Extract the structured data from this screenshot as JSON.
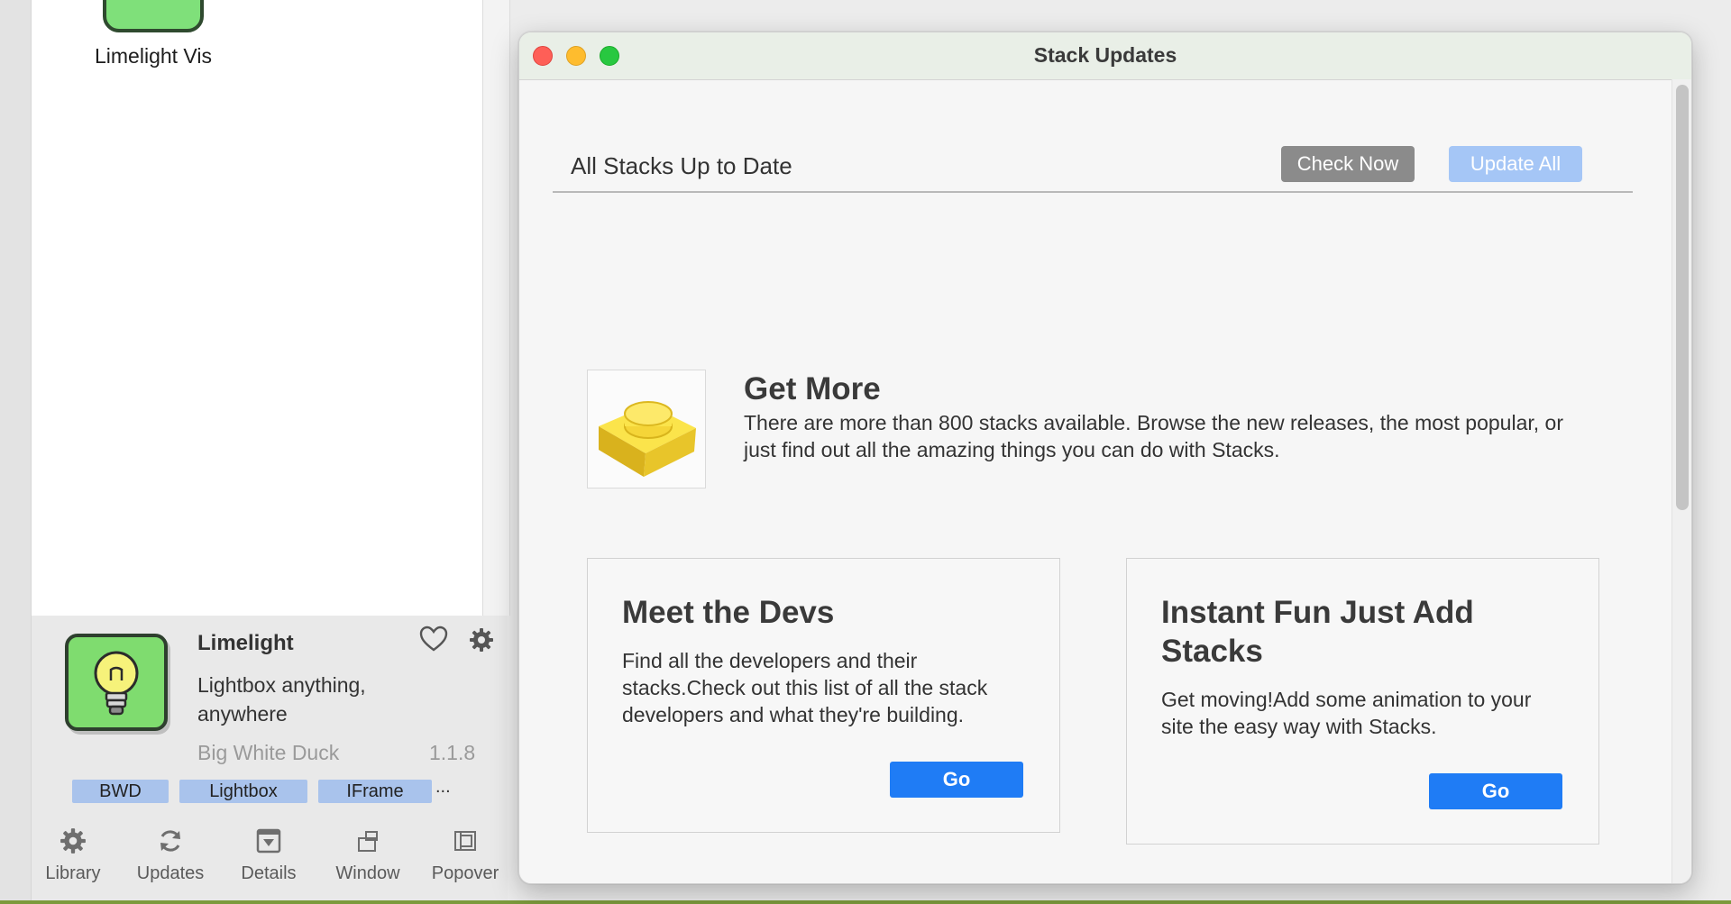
{
  "library": {
    "top_stack_name": "Limelight Vis"
  },
  "detail": {
    "title": "Limelight",
    "description": "Lightbox anything, anywhere",
    "author": "Big White Duck",
    "version": "1.1.8",
    "tags": [
      "BWD",
      "Lightbox",
      "IFrame"
    ],
    "tags_more": "..."
  },
  "toolbar": {
    "items": [
      {
        "label": "Library",
        "icon": "gear-icon"
      },
      {
        "label": "Updates",
        "icon": "refresh-icon"
      },
      {
        "label": "Details",
        "icon": "details-icon"
      },
      {
        "label": "Window",
        "icon": "window-icon"
      },
      {
        "label": "Popover",
        "icon": "popover-icon"
      }
    ]
  },
  "window": {
    "title": "Stack Updates",
    "status": "All Stacks Up to Date",
    "check_now_label": "Check Now",
    "update_all_label": "Update All",
    "get_more": {
      "title": "Get More",
      "text": "There are more than 800 stacks available. Browse the new releases, the most popular, or just find out all the amazing things you can do with Stacks."
    },
    "cards": [
      {
        "title": "Meet the Devs",
        "text": "Find all the developers and their stacks.Check out this list of all the stack developers and what they're building.",
        "button": "Go"
      },
      {
        "title": "Instant Fun Just Add Stacks",
        "text": "Get moving!Add some animation to your site the easy way with Stacks.",
        "button": "Go"
      }
    ]
  },
  "colors": {
    "accent_blue": "#1f7cf5",
    "disabled_blue": "#a5c6f6",
    "tag_blue": "#a9c3ec",
    "icon_green": "#7fdc6f"
  }
}
